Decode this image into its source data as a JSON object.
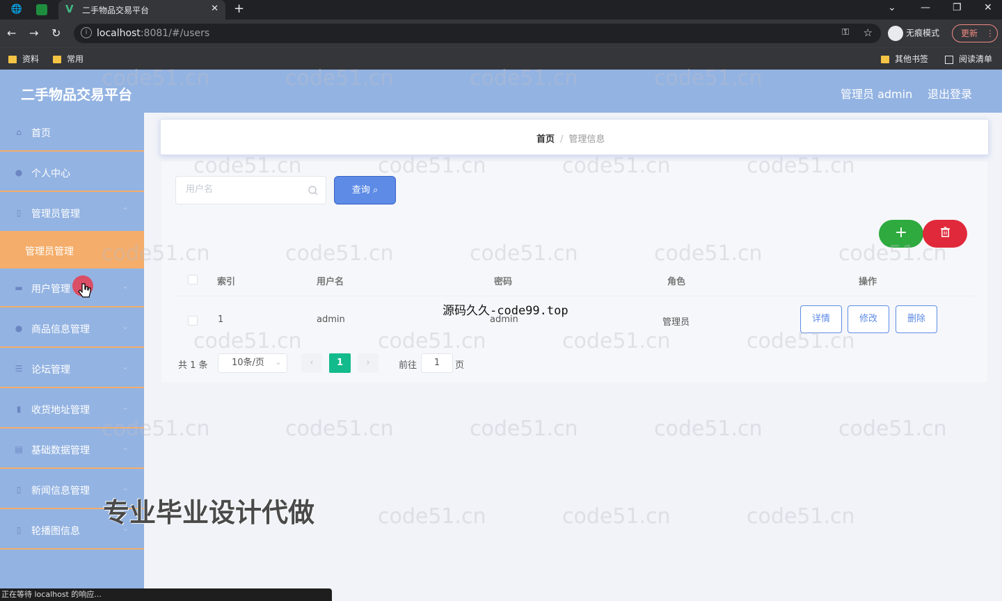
{
  "browser": {
    "tab_title": "二手物品交易平台",
    "url_host": "localhost",
    "url_path": ":8081/#/users",
    "incognito_label": "无痕模式",
    "update_label": "更新",
    "bookmarks": [
      "资料",
      "常用"
    ],
    "bookmarks_right": [
      "其他书签",
      "阅读清单"
    ]
  },
  "app": {
    "title": "二手物品交易平台",
    "user_label": "管理员 admin",
    "logout_label": "退出登录"
  },
  "sidebar": {
    "items": [
      {
        "label": "首页",
        "icon": "home-icon"
      },
      {
        "label": "个人中心",
        "icon": "user-icon"
      },
      {
        "label": "管理员管理",
        "icon": "doc-icon"
      },
      {
        "label": "用户管理",
        "icon": "group-icon"
      },
      {
        "label": "商品信息管理",
        "icon": "user-icon"
      },
      {
        "label": "论坛管理",
        "icon": "list-icon"
      },
      {
        "label": "收货地址管理",
        "icon": "chart-icon"
      },
      {
        "label": "基础数据管理",
        "icon": "box-icon"
      },
      {
        "label": "新闻信息管理",
        "icon": "doc-icon"
      },
      {
        "label": "轮播图信息",
        "icon": "image-icon"
      }
    ],
    "sub_item": "管理员管理"
  },
  "breadcrumb": {
    "home": "首页",
    "current": "管理信息"
  },
  "search": {
    "placeholder": "用户名",
    "button_label": "查询"
  },
  "table": {
    "headers": [
      "索引",
      "用户名",
      "密码",
      "角色",
      "操作"
    ],
    "rows": [
      {
        "index": "1",
        "username": "admin",
        "password": "admin",
        "role": "管理员"
      }
    ],
    "actions": [
      "详情",
      "修改",
      "删除"
    ]
  },
  "pagination": {
    "total": "共 1 条",
    "page_size": "10条/页",
    "current_page": "1",
    "goto_label": "前往",
    "goto_value": "1",
    "page_unit": "页"
  },
  "status_text": "正在等待 localhost 的响应...",
  "overlays": {
    "watermark": "code51.cn",
    "site_text": "源码久久-code99.top",
    "ad_text": "专业毕业设计代做"
  },
  "colors": {
    "header_bg": "#93b3e2",
    "active_menu": "#f4ad6a",
    "primary": "#5d8be6",
    "add": "#2eaa3f",
    "delete": "#e0293a",
    "page_active": "#13ba8c"
  }
}
